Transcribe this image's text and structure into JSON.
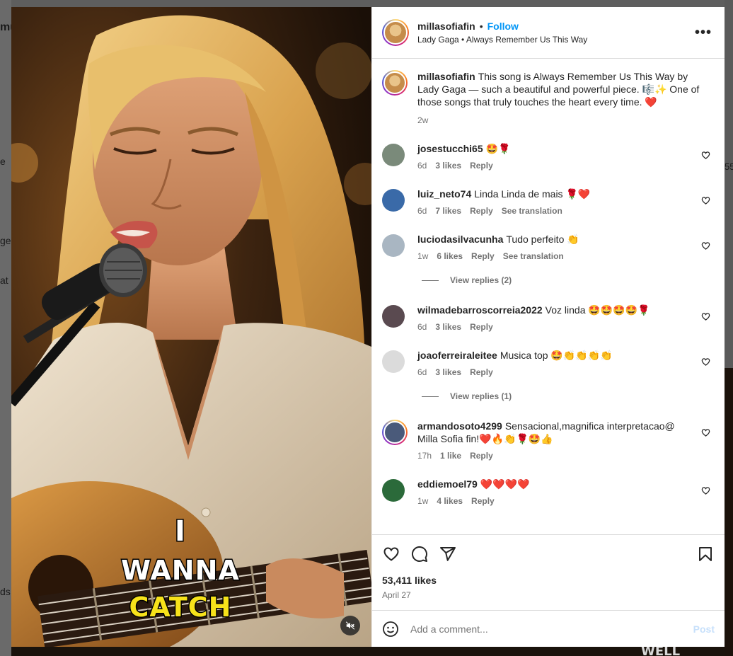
{
  "background": {
    "fragments": [
      "mu",
      "e",
      "ge",
      "at",
      "ds",
      "55",
      "WELL"
    ]
  },
  "post": {
    "media": {
      "caption_lines": [
        "I",
        "WANNA",
        "CATCH"
      ],
      "caption_highlight_color": "#f7e21a",
      "mute_icon": "muted-speaker-icon"
    },
    "header": {
      "username": "millasofiafin",
      "separator": "•",
      "follow_label": "Follow",
      "audio": "Lady Gaga • Always Remember Us This Way",
      "more_icon": "more-horizontal-icon"
    },
    "description": {
      "username": "millasofiafin",
      "text": "This song is Always Remember Us This Way by Lady Gaga — such a beautiful and powerful piece. 🎼✨ One of those songs that truly touches the heart every time. ❤️",
      "time": "2w"
    },
    "comments": [
      {
        "username": "josestucchi65",
        "text": "🤩🌹",
        "time": "6d",
        "likes": "3 likes",
        "reply": "Reply",
        "translation": "",
        "avatar_color": "#7a8a7a"
      },
      {
        "username": "luiz_neto74",
        "text": "Linda Linda de mais 🌹❤️",
        "time": "6d",
        "likes": "7 likes",
        "reply": "Reply",
        "translation": "See translation",
        "avatar_color": "#3a6aa8"
      },
      {
        "username": "luciodasilvacunha",
        "text": "Tudo perfeito 👏",
        "time": "1w",
        "likes": "6 likes",
        "reply": "Reply",
        "translation": "See translation",
        "avatar_color": "#a9b6c2",
        "view_replies": "View replies (2)"
      },
      {
        "username": "wilmadebarroscorreia2022",
        "text": "Voz linda 🤩🤩🤩🤩🌹",
        "time": "6d",
        "likes": "3 likes",
        "reply": "Reply",
        "translation": "",
        "avatar_color": "#5a4a50"
      },
      {
        "username": "joaoferreiraleitee",
        "text": "Musica top 🤩👏👏👏👏",
        "time": "6d",
        "likes": "3 likes",
        "reply": "Reply",
        "translation": "",
        "avatar_color": "#dbdbdb",
        "view_replies": "View replies (1)"
      },
      {
        "username": "armandosoto4299",
        "text": "Sensacional,magnifica interpretacao@ Milla Sofia fin!❤️🔥👏🌹🤩👍",
        "time": "17h",
        "likes": "1 like",
        "reply": "Reply",
        "translation": "",
        "avatar_color": "#4a5a7a"
      },
      {
        "username": "eddiemoel79",
        "text": "❤️❤️❤️❤️",
        "time": "1w",
        "likes": "4 likes",
        "reply": "Reply",
        "translation": "",
        "avatar_color": "#2b6a3a"
      }
    ],
    "actions": {
      "like_icon": "heart-icon",
      "comment_icon": "comment-icon",
      "share_icon": "share-icon",
      "save_icon": "bookmark-icon",
      "likes": "53,411 likes",
      "date": "April 27"
    },
    "add_comment": {
      "emoji_icon": "emoji-icon",
      "placeholder": "Add a comment...",
      "post_label": "Post"
    }
  }
}
